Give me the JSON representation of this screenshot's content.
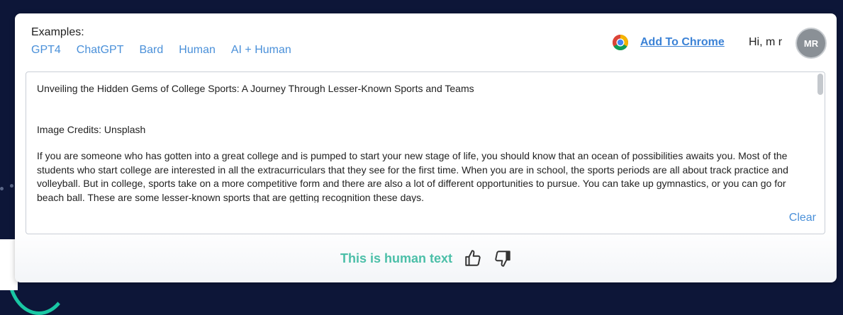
{
  "examples": {
    "label": "Examples:",
    "links": [
      "GPT4",
      "ChatGPT",
      "Bard",
      "Human",
      "AI + Human"
    ]
  },
  "header": {
    "add_to_chrome": "Add To Chrome",
    "greeting": "Hi, m r",
    "avatar_initials": "MR"
  },
  "editor": {
    "title_line": "Unveiling the Hidden Gems of College Sports: A Journey Through Lesser-Known Sports and Teams",
    "credits_line": "Image Credits: Unsplash",
    "paragraph": "If you are someone who has gotten into a great college and is pumped to start your new stage of life, you should know that an ocean of possibilities awaits you. Most of the students who start college are interested in all the extracurriculars that they see for the first time. When you are in school, the sports periods are all about track practice and volleyball. But in college, sports take on a more competitive form and there are also a lot of different opportunities to pursue. You can take up gymnastics, or you can go for beach ball. These are some lesser-known sports that are getting recognition these days.",
    "clear_label": "Clear"
  },
  "result": {
    "text": "This is human text"
  },
  "icons": [
    "chrome-icon",
    "thumbs-up-icon",
    "thumbs-down-icon"
  ],
  "colors": {
    "accent_link": "#4a90d9",
    "result_green": "#4bbfa8",
    "background": "#0d1638"
  }
}
